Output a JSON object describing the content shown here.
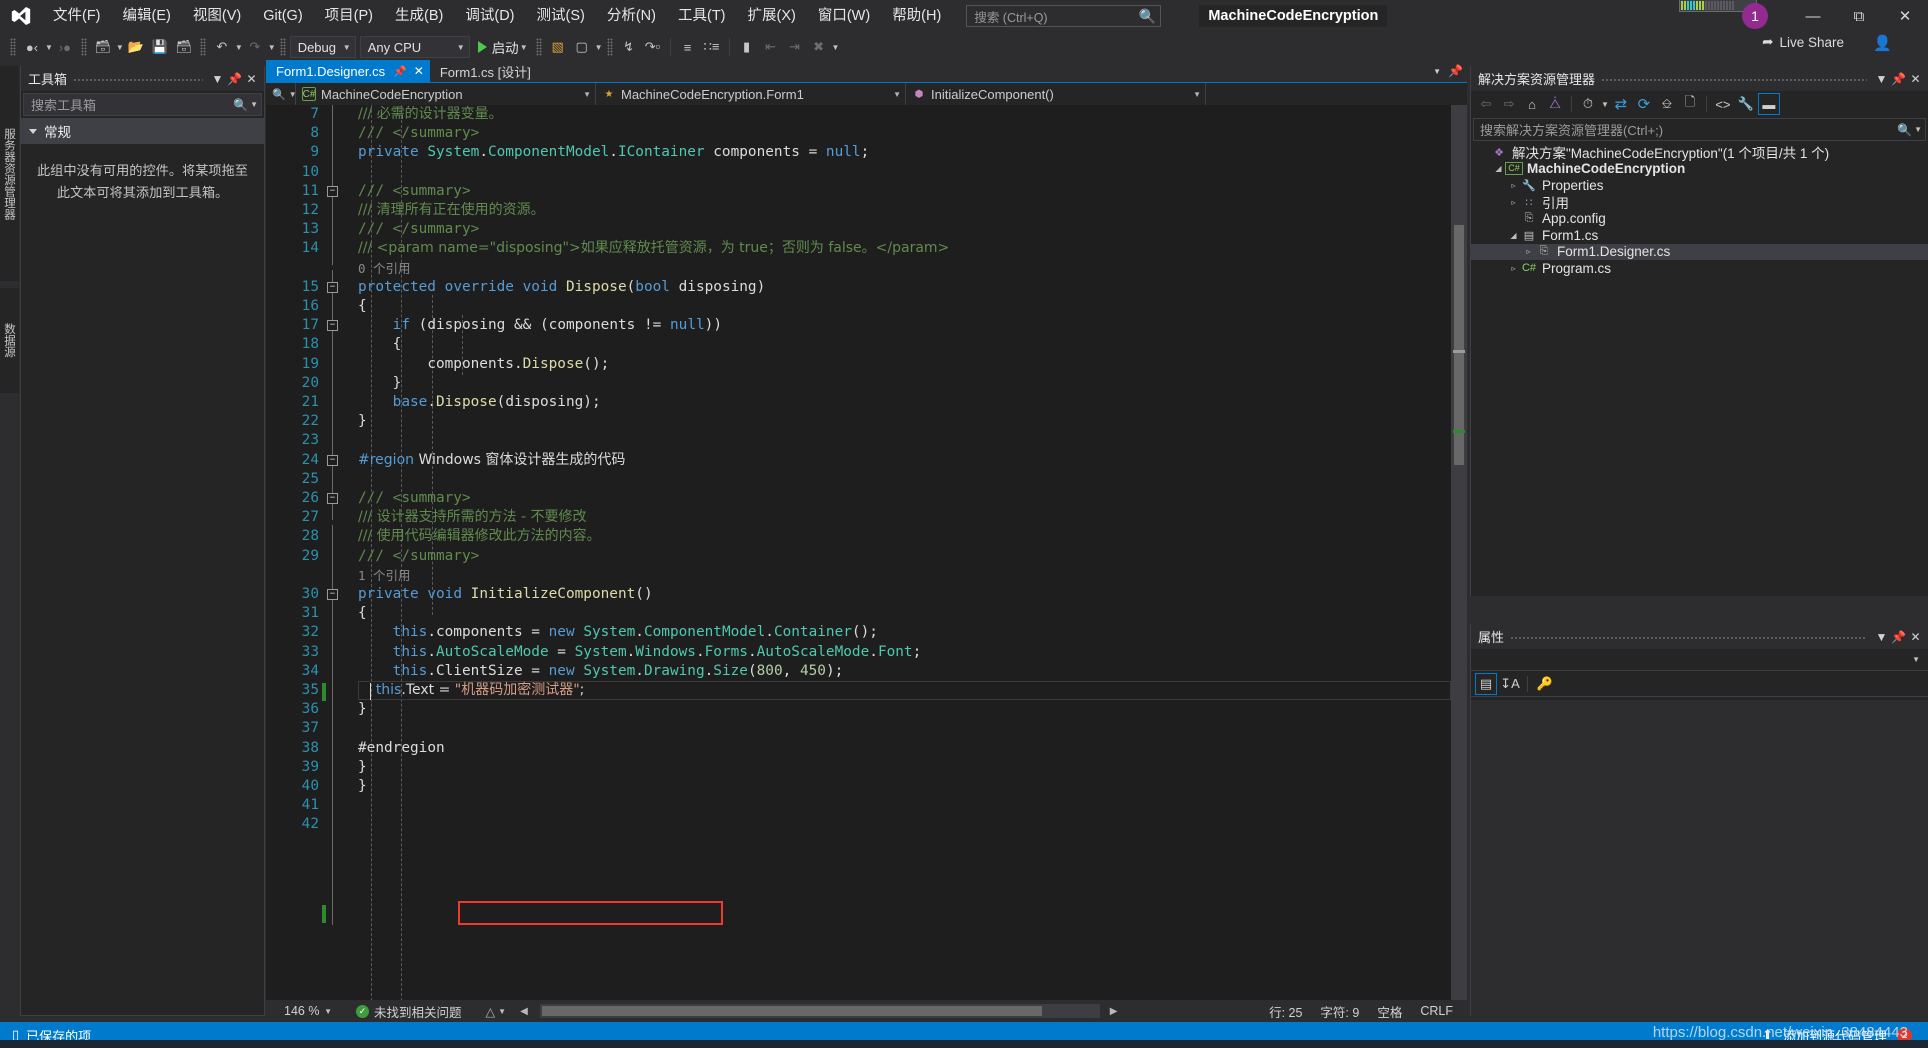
{
  "titlebar": {
    "logo_icon": "visual-studio-logo",
    "menus": [
      "文件(F)",
      "编辑(E)",
      "视图(V)",
      "Git(G)",
      "项目(P)",
      "生成(B)",
      "调试(D)",
      "测试(S)",
      "分析(N)",
      "工具(T)",
      "扩展(X)",
      "窗口(W)",
      "帮助(H)"
    ],
    "search_placeholder": "搜索 (Ctrl+Q)",
    "search_icon": "magnifier-icon",
    "project_title": "MachineCodeEncryption",
    "notification_count": "1",
    "minimize_icon": "minimize-icon",
    "maximize_icon": "maximize-icon",
    "close_icon": "close-icon"
  },
  "toolbar": {
    "nav_back_icon": "navigate-back-icon",
    "nav_forward_icon": "navigate-forward-icon",
    "new_project_icon": "new-project-icon",
    "open_icon": "open-folder-icon",
    "save_icon": "save-icon",
    "save_all_icon": "save-all-icon",
    "undo_icon": "undo-icon",
    "redo_icon": "redo-icon",
    "config_value": "Debug",
    "platform_value": "Any CPU",
    "start_label": "启动",
    "start_icon": "play-icon",
    "live_share_label": "Live Share",
    "live_share_icon": "live-share-icon",
    "account_icon": "account-person-icon"
  },
  "vtabs": [
    {
      "label": "服务器资源管理器"
    },
    {
      "label": "数据源"
    }
  ],
  "toolbox": {
    "title": "工具箱",
    "search_placeholder": "搜索工具箱",
    "search_icon": "magnifier-icon",
    "group_label": "常规",
    "empty_text": "此组中没有可用的控件。将某项拖至此文本可将其添加到工具箱。",
    "dropdown_icon": "chevron-down-icon",
    "pin_icon": "pin-icon",
    "close_icon": "close-icon"
  },
  "editor": {
    "tabs": [
      {
        "label": "Form1.Designer.cs",
        "active": true,
        "pin_icon": "pin-icon",
        "close_icon": "close-icon"
      },
      {
        "label": "Form1.cs [设计]",
        "active": false
      }
    ],
    "breadcrumb": [
      {
        "label": "MachineCodeEncryption",
        "icon": "csharp-project-icon"
      },
      {
        "label": "MachineCodeEncryption.Form1",
        "icon": "class-icon"
      },
      {
        "label": "InitializeComponent()",
        "icon": "private-method-icon"
      }
    ],
    "nav_search_icon": "magnifier-icon",
    "lines": [
      {
        "n": 7,
        "kind": "comment",
        "text": "/// 必需的设计器变量。",
        "cjk": true,
        "clipped": true
      },
      {
        "n": 8,
        "kind": "comment",
        "text": "/// </summary>"
      },
      {
        "n": 9,
        "kind": "code",
        "text": "private System.ComponentModel.IContainer components = null;"
      },
      {
        "n": 10,
        "kind": "blank",
        "text": ""
      },
      {
        "n": 11,
        "kind": "comment",
        "text": "/// <summary>",
        "fold": true
      },
      {
        "n": 12,
        "kind": "comment",
        "text": "/// 清理所有正在使用的资源。",
        "cjk": true
      },
      {
        "n": 13,
        "kind": "comment",
        "text": "/// </summary>"
      },
      {
        "n": 14,
        "kind": "comment",
        "text": "/// <param name=\"disposing\">如果应释放托管资源，为 true；否则为 false。</param>",
        "cjk": true
      },
      {
        "n": null,
        "kind": "reference",
        "text": "0 个引用"
      },
      {
        "n": 15,
        "kind": "code",
        "text": "protected override void Dispose(bool disposing)",
        "fold": true
      },
      {
        "n": 16,
        "kind": "code",
        "text": "{"
      },
      {
        "n": 17,
        "kind": "code",
        "text": "    if (disposing && (components != null))",
        "fold": true
      },
      {
        "n": 18,
        "kind": "code",
        "text": "    {"
      },
      {
        "n": 19,
        "kind": "code",
        "text": "        components.Dispose();"
      },
      {
        "n": 20,
        "kind": "code",
        "text": "    }"
      },
      {
        "n": 21,
        "kind": "code",
        "text": "    base.Dispose(disposing);"
      },
      {
        "n": 22,
        "kind": "code",
        "text": "}"
      },
      {
        "n": 23,
        "kind": "blank",
        "text": ""
      },
      {
        "n": 24,
        "kind": "region",
        "text": "#region Windows 窗体设计器生成的代码",
        "fold": true,
        "cjk": true
      },
      {
        "n": 25,
        "kind": "blank",
        "text": "",
        "current": true
      },
      {
        "n": 26,
        "kind": "comment",
        "text": "/// <summary>",
        "fold": true
      },
      {
        "n": 27,
        "kind": "comment",
        "text": "/// 设计器支持所需的方法 - 不要修改",
        "cjk": true
      },
      {
        "n": 28,
        "kind": "comment",
        "text": "/// 使用代码编辑器修改此方法的内容。",
        "cjk": true
      },
      {
        "n": 29,
        "kind": "comment",
        "text": "/// </summary>"
      },
      {
        "n": null,
        "kind": "reference",
        "text": "1 个引用"
      },
      {
        "n": 30,
        "kind": "code",
        "text": "private void InitializeComponent()",
        "fold": true
      },
      {
        "n": 31,
        "kind": "code",
        "text": "{"
      },
      {
        "n": 32,
        "kind": "code",
        "text": "    this.components = new System.ComponentModel.Container();"
      },
      {
        "n": 33,
        "kind": "code",
        "text": "    this.AutoScaleMode = System.Windows.Forms.AutoScaleMode.Font;"
      },
      {
        "n": 34,
        "kind": "code",
        "text": "    this.ClientSize = new System.Drawing.Size(800, 450);"
      },
      {
        "n": 35,
        "kind": "code",
        "text": "    this.Text = \"机器码加密测试器\";",
        "cjk": true,
        "highlight": true,
        "changed": true
      },
      {
        "n": 36,
        "kind": "code",
        "text": "}"
      },
      {
        "n": 37,
        "kind": "blank",
        "text": ""
      },
      {
        "n": 38,
        "kind": "code",
        "text": "#endregion"
      },
      {
        "n": 39,
        "kind": "code",
        "text": "}"
      },
      {
        "n": 40,
        "kind": "code",
        "text": "}"
      },
      {
        "n": 41,
        "kind": "blank",
        "text": ""
      },
      {
        "n": 42,
        "kind": "blank",
        "text": ""
      }
    ],
    "status": {
      "zoom": "146 %",
      "issues": "未找到相关问题",
      "issues_icon": "check-circle-icon",
      "line": "行: 25",
      "column": "字符: 9",
      "spaces": "空格",
      "eol": "CRLF"
    }
  },
  "solution_explorer": {
    "title": "解决方案资源管理器",
    "search_placeholder": "搜索解决方案资源管理器(Ctrl+;)",
    "search_icon": "magnifier-icon",
    "dropdown_icon": "chevron-down-icon",
    "pin_icon": "pin-icon",
    "close_icon": "close-icon",
    "toolbar_icons": [
      "back-icon",
      "forward-icon",
      "home-icon",
      "solution-icon",
      "pending-changes-icon",
      "sync-icon",
      "refresh-icon",
      "collapse-all-icon",
      "show-all-files-icon",
      "view-code-icon",
      "properties-wrench-icon",
      "preview-selected-icon"
    ],
    "tree": [
      {
        "depth": 0,
        "arrow": "none",
        "icon": "solution-icon",
        "label": "解决方案\"MachineCodeEncryption\"(1 个项目/共 1 个)",
        "bold": false,
        "selected": false
      },
      {
        "depth": 1,
        "arrow": "open",
        "icon": "csharp-project-icon",
        "label": "MachineCodeEncryption",
        "bold": true,
        "selected": false
      },
      {
        "depth": 2,
        "arrow": "closed",
        "icon": "wrench-icon",
        "label": "Properties",
        "bold": false,
        "selected": false
      },
      {
        "depth": 2,
        "arrow": "closed",
        "icon": "references-icon",
        "label": "引用",
        "bold": false,
        "selected": false
      },
      {
        "depth": 2,
        "arrow": "none",
        "icon": "config-file-icon",
        "label": "App.config",
        "bold": false,
        "selected": false
      },
      {
        "depth": 2,
        "arrow": "open",
        "icon": "form-icon",
        "label": "Form1.cs",
        "bold": false,
        "selected": false
      },
      {
        "depth": 3,
        "arrow": "closed",
        "icon": "designer-file-icon",
        "label": "Form1.Designer.cs",
        "bold": false,
        "selected": true
      },
      {
        "depth": 2,
        "arrow": "closed",
        "icon": "csharp-file-icon",
        "label": "Program.cs",
        "bold": false,
        "selected": false
      }
    ]
  },
  "properties": {
    "title": "属性",
    "dropdown_icon": "chevron-down-icon",
    "pin_icon": "pin-icon",
    "close_icon": "close-icon",
    "categorized_icon": "categorized-view-icon",
    "alphabetical_icon": "alphabetical-sort-icon",
    "property_pages_icon": "property-pages-icon"
  },
  "bottombar": {
    "saved_icon": "saved-item-icon",
    "saved_label": "已保存的项",
    "source_control_label": "添加到源代码管理",
    "source_control_icon": "source-control-up-icon",
    "error_count": "2",
    "watermark": "https://blog.csdn.net/weixin_38484443"
  },
  "colors": {
    "accent": "#007acc",
    "titlebar_bg": "#2d2d30",
    "editor_bg": "#1e1e1e",
    "panel_bg": "#252526",
    "highlight_red": "#ef3b2d",
    "badge_purple": "#932a90",
    "comment_green": "#57a64a",
    "keyword_blue": "#569cd6",
    "string_orange": "#d69d85",
    "type_teal": "#4ec9b0",
    "method_yellow": "#dcdcaa",
    "number_green": "#b5cea8"
  }
}
